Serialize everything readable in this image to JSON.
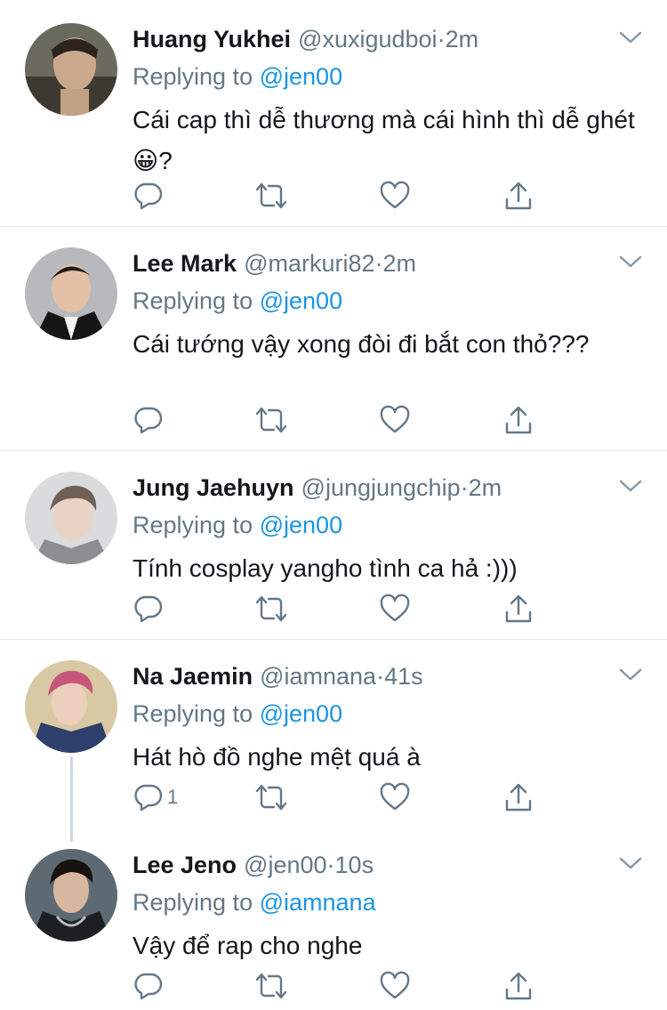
{
  "tweets": [
    {
      "name": "Huang Yukhei",
      "handle": "@xuxigudboi",
      "time": "2m",
      "replying_prefix": "Replying to",
      "replying_to": "@jen00",
      "text": "Cái cap thì dễ thương mà cái hình thì dễ ghét😀?",
      "reply_count": ""
    },
    {
      "name": "Lee Mark",
      "handle": "@markuri82",
      "time": "2m",
      "replying_prefix": "Replying to",
      "replying_to": "@jen00",
      "text": "Cái tướng vậy xong đòi đi bắt con thỏ???",
      "reply_count": ""
    },
    {
      "name": "Jung Jaehuyn",
      "handle": "@jungjungchip",
      "time": "2m",
      "replying_prefix": "Replying to",
      "replying_to": "@jen00",
      "text": "Tính cosplay yangho tình ca hả :)))",
      "reply_count": ""
    },
    {
      "name": "Na Jaemin",
      "handle": "@iamnana",
      "time": "41s",
      "replying_prefix": "Replying to",
      "replying_to": "@jen00",
      "text": "Hát hò đồ nghe mệt quá à",
      "reply_count": "1"
    },
    {
      "name": "Lee Jeno",
      "handle": "@jen00",
      "time": "10s",
      "replying_prefix": "Replying to",
      "replying_to": "@iamnana",
      "text": "Vậy để rap cho nghe",
      "reply_count": ""
    }
  ],
  "separator": "·",
  "icons": [
    "reply-icon",
    "retweet-icon",
    "like-icon",
    "share-icon",
    "chevron-down-icon"
  ],
  "colors": {
    "link": "#1b95e0",
    "secondary": "#657786",
    "text": "#14171a",
    "divider": "#e1e8ed"
  }
}
